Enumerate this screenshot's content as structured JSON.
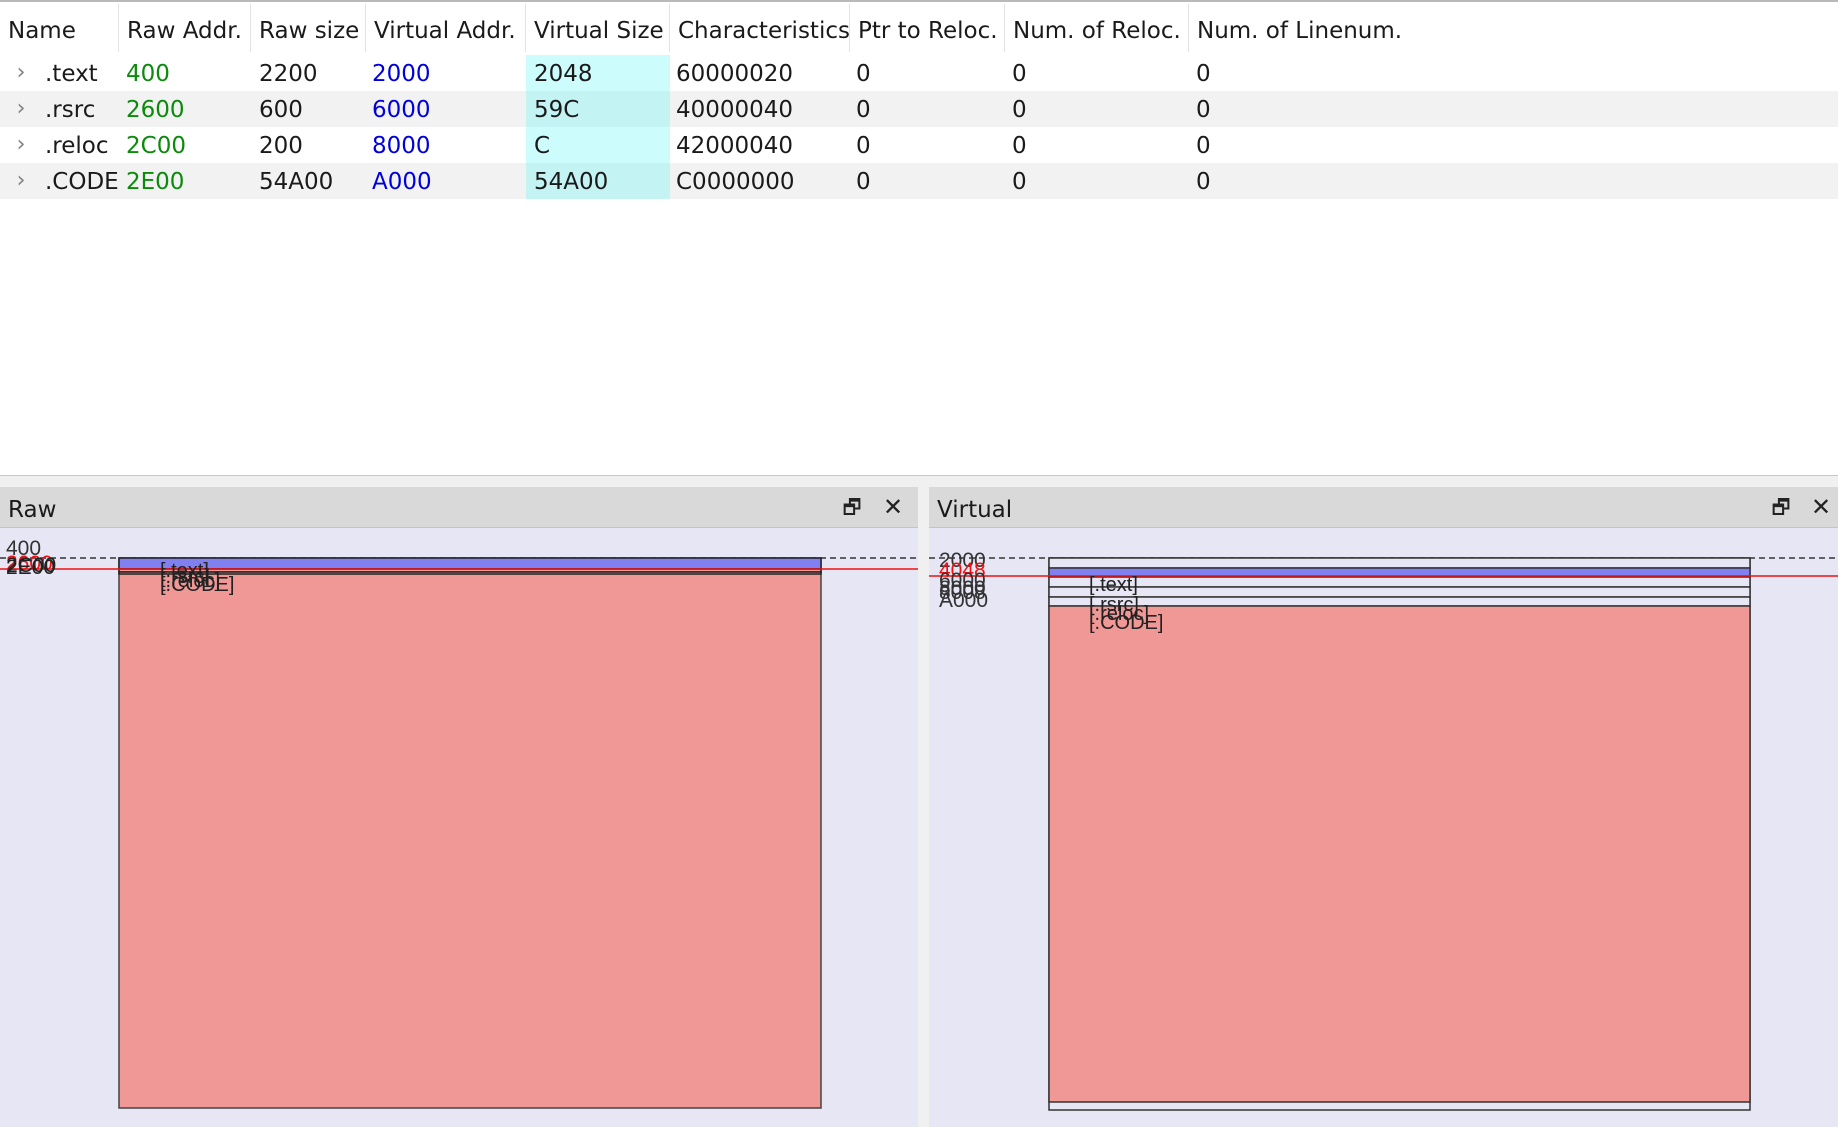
{
  "table": {
    "columns": [
      "Name",
      "Raw Addr.",
      "Raw size",
      "Virtual Addr.",
      "Virtual Size",
      "Characteristics",
      "Ptr to Reloc.",
      "Num. of Reloc.",
      "Num. of Linenum."
    ],
    "rows": [
      {
        "name": ".text",
        "raw_addr": "400",
        "raw_size": "2200",
        "virtual_addr": "2000",
        "virtual_size": "2048",
        "characteristics": "60000020",
        "ptr_to_reloc": "0",
        "num_reloc": "0",
        "num_linenum": "0"
      },
      {
        "name": ".rsrc",
        "raw_addr": "2600",
        "raw_size": "600",
        "virtual_addr": "6000",
        "virtual_size": "59C",
        "characteristics": "40000040",
        "ptr_to_reloc": "0",
        "num_reloc": "0",
        "num_linenum": "0"
      },
      {
        "name": ".reloc",
        "raw_addr": "2C00",
        "raw_size": "200",
        "virtual_addr": "8000",
        "virtual_size": "C",
        "characteristics": "42000040",
        "ptr_to_reloc": "0",
        "num_reloc": "0",
        "num_linenum": "0"
      },
      {
        "name": ".CODE",
        "raw_addr": "2E00",
        "raw_size": "54A00",
        "virtual_addr": "A000",
        "virtual_size": "54A00",
        "characteristics": "C0000000",
        "ptr_to_reloc": "0",
        "num_reloc": "0",
        "num_linenum": "0"
      }
    ]
  },
  "raw_panel": {
    "title": "Raw",
    "float_icon": "restore-window-icon",
    "close_icon": "close-icon",
    "address_labels": [
      "400",
      "2600",
      "2C00",
      "2E00"
    ],
    "section_labels": [
      "[.text]",
      "[.rsrc]",
      "[.reloc]",
      "[.CODE]"
    ]
  },
  "virtual_panel": {
    "title": "Virtual",
    "float_icon": "restore-window-icon",
    "close_icon": "close-icon",
    "address_labels": [
      "2000",
      "4048",
      "6000",
      "8000",
      "8008",
      "A000"
    ],
    "section_labels": [
      "[.text]",
      "[.rsrc]",
      "[.reloc]",
      "[.CODE]"
    ]
  },
  "colors": {
    "raw_addr": "#0b8a0b",
    "virtual_addr": "#0000dd",
    "virtual_size_bg": "#ccfcfc",
    "section_fill": "#f09896",
    "selected_section_fill": "#8080f0",
    "marker_line": "#ee1111",
    "panel_bg": "#e6e6f4"
  }
}
